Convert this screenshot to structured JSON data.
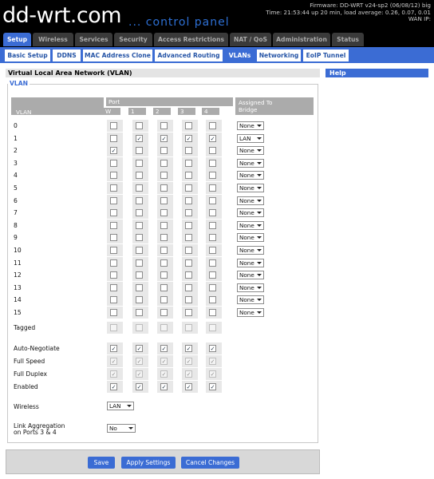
{
  "header": {
    "logo": "dd-wrt.com",
    "logo_sub": "... control panel",
    "firmware": "Firmware: DD-WRT v24-sp2 (06/08/12) big",
    "time": "Time: 21:53:44 up 20 min, load average: 0.26, 0.07, 0.01",
    "wan_ip": "WAN IP:"
  },
  "main_tabs": [
    {
      "label": "Setup",
      "active": true
    },
    {
      "label": "Wireless",
      "active": false
    },
    {
      "label": "Services",
      "active": false
    },
    {
      "label": "Security",
      "active": false
    },
    {
      "label": "Access Restrictions",
      "active": false
    },
    {
      "label": "NAT / QoS",
      "active": false
    },
    {
      "label": "Administration",
      "active": false
    },
    {
      "label": "Status",
      "active": false
    }
  ],
  "sub_tabs": [
    {
      "label": "Basic Setup",
      "active": false
    },
    {
      "label": "DDNS",
      "active": false
    },
    {
      "label": "MAC Address Clone",
      "active": false
    },
    {
      "label": "Advanced Routing",
      "active": false
    },
    {
      "label": "VLANs",
      "active": true
    },
    {
      "label": "Networking",
      "active": false
    },
    {
      "label": "EoIP Tunnel",
      "active": false
    }
  ],
  "section_title": "Virtual Local Area Network (VLAN)",
  "fieldset_legend": "VLAN",
  "table": {
    "col_vlan": "VLAN",
    "col_port": "Port",
    "col_assigned": "Assigned To",
    "col_bridge": "Bridge",
    "ports": [
      "W",
      "1",
      "2",
      "3",
      "4"
    ],
    "rows": [
      {
        "label": "0",
        "checks": [
          false,
          false,
          false,
          false,
          false
        ],
        "bridge": "None"
      },
      {
        "label": "1",
        "checks": [
          false,
          true,
          true,
          true,
          true
        ],
        "bridge": "LAN"
      },
      {
        "label": "2",
        "checks": [
          true,
          false,
          false,
          false,
          false
        ],
        "bridge": "None"
      },
      {
        "label": "3",
        "checks": [
          false,
          false,
          false,
          false,
          false
        ],
        "bridge": "None"
      },
      {
        "label": "4",
        "checks": [
          false,
          false,
          false,
          false,
          false
        ],
        "bridge": "None"
      },
      {
        "label": "5",
        "checks": [
          false,
          false,
          false,
          false,
          false
        ],
        "bridge": "None"
      },
      {
        "label": "6",
        "checks": [
          false,
          false,
          false,
          false,
          false
        ],
        "bridge": "None"
      },
      {
        "label": "7",
        "checks": [
          false,
          false,
          false,
          false,
          false
        ],
        "bridge": "None"
      },
      {
        "label": "8",
        "checks": [
          false,
          false,
          false,
          false,
          false
        ],
        "bridge": "None"
      },
      {
        "label": "9",
        "checks": [
          false,
          false,
          false,
          false,
          false
        ],
        "bridge": "None"
      },
      {
        "label": "10",
        "checks": [
          false,
          false,
          false,
          false,
          false
        ],
        "bridge": "None"
      },
      {
        "label": "11",
        "checks": [
          false,
          false,
          false,
          false,
          false
        ],
        "bridge": "None"
      },
      {
        "label": "12",
        "checks": [
          false,
          false,
          false,
          false,
          false
        ],
        "bridge": "None"
      },
      {
        "label": "13",
        "checks": [
          false,
          false,
          false,
          false,
          false
        ],
        "bridge": "None"
      },
      {
        "label": "14",
        "checks": [
          false,
          false,
          false,
          false,
          false
        ],
        "bridge": "None"
      },
      {
        "label": "15",
        "checks": [
          false,
          false,
          false,
          false,
          false
        ],
        "bridge": "None"
      }
    ],
    "tagged": {
      "label": "Tagged",
      "checks": [
        false,
        false,
        false,
        false,
        false
      ]
    },
    "port_settings": [
      {
        "label": "Auto-Negotiate",
        "checks": [
          true,
          true,
          true,
          true,
          true
        ],
        "disabled": false
      },
      {
        "label": "Full Speed",
        "checks": [
          true,
          true,
          true,
          true,
          true
        ],
        "disabled": true
      },
      {
        "label": "Full Duplex",
        "checks": [
          true,
          true,
          true,
          true,
          true
        ],
        "disabled": true
      },
      {
        "label": "Enabled",
        "checks": [
          true,
          true,
          true,
          true,
          true
        ],
        "disabled": false
      }
    ]
  },
  "wireless": {
    "label": "Wireless",
    "value": "LAN"
  },
  "link_agg": {
    "label_1": "Link Aggregation",
    "label_2": "on Ports 3 & 4",
    "value": "No"
  },
  "help_title": "Help",
  "buttons": {
    "save": "Save",
    "apply": "Apply Settings",
    "cancel": "Cancel Changes"
  },
  "colors": {
    "accent": "#3b6cd4",
    "header_bg": "#000000",
    "table_header": "#ababab"
  }
}
